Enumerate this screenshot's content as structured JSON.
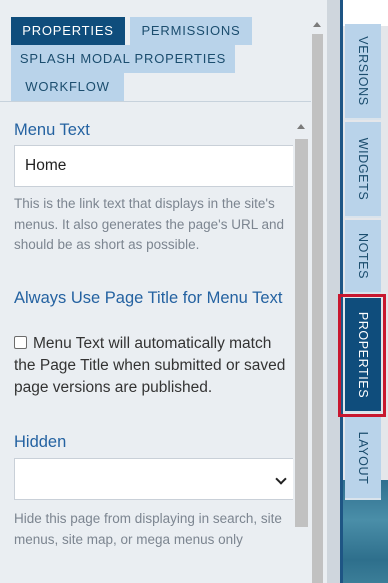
{
  "tabs": {
    "properties": "PROPERTIES",
    "permissions": "PERMISSIONS",
    "splash": "SPLASH MODAL PROPERTIES",
    "workflow": "WORKFLOW"
  },
  "menu_text": {
    "label": "Menu Text",
    "value": "Home",
    "help": "This is the link text that displays in the site's menus. It also generates the page's URL and should be as short as possible."
  },
  "always_use_title": {
    "label": "Always Use Page Title for Menu Text",
    "checkbox_text": "Menu Text will automatically match the Page Title when submitted or saved page versions are published."
  },
  "hidden": {
    "label": "Hidden",
    "value": "",
    "help": "Hide this page from displaying in search, site menus, site map, or mega menus only"
  },
  "side_tabs": {
    "versions": "VERSIONS",
    "widgets": "WIDGETS",
    "notes": "NOTES",
    "properties": "PROPERTIES",
    "layout": "LAYOUT"
  },
  "colors": {
    "active_tab": "#0f4d7c",
    "inactive_tab": "#b9d3ea",
    "label_blue": "#2462a1",
    "highlight_red": "#c8172f"
  }
}
